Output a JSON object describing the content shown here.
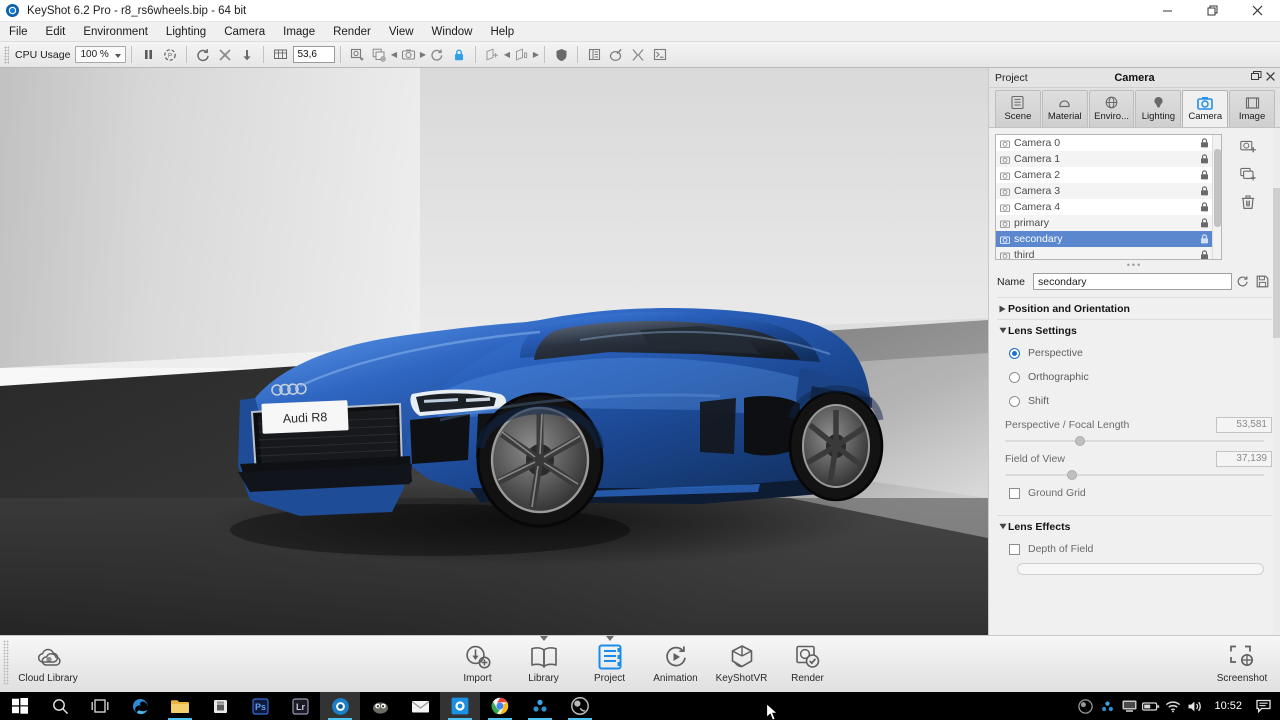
{
  "window": {
    "title": "KeyShot 6.2 Pro  - r8_rs6wheels.bip  - 64 bit",
    "logo_icon": "keyshot-logo-icon",
    "minimize_icon": "minimize-icon",
    "restore_icon": "restore-icon",
    "close_icon": "close-icon"
  },
  "menubar": {
    "items": [
      {
        "label": "File"
      },
      {
        "label": "Edit"
      },
      {
        "label": "Environment"
      },
      {
        "label": "Lighting"
      },
      {
        "label": "Camera"
      },
      {
        "label": "Image"
      },
      {
        "label": "Render"
      },
      {
        "label": "View"
      },
      {
        "label": "Window"
      },
      {
        "label": "Help"
      }
    ]
  },
  "toolbar": {
    "cpu_usage_label": "CPU Usage",
    "cpu_usage_value": "100 %",
    "numeric_value": "53,6",
    "buttons": [
      {
        "name": "pause-button",
        "icon": "pause-icon"
      },
      {
        "name": "performance-mode-button",
        "icon": "performance-icon"
      },
      {
        "name": "rotate-button",
        "icon": "rotate-icon"
      },
      {
        "name": "move-button",
        "icon": "move-icon"
      },
      {
        "name": "drop-to-ground-button",
        "icon": "down-arrow-icon"
      },
      {
        "name": "grid-button",
        "icon": "grid-icon"
      },
      {
        "name": "zoom-to-fit-button",
        "icon": "zoom-fit-icon"
      },
      {
        "name": "copy-view-button",
        "icon": "copy-view-icon"
      },
      {
        "name": "prev-camera-button",
        "icon": "left-arrow-icon"
      },
      {
        "name": "camera-button",
        "icon": "camera-icon"
      },
      {
        "name": "next-camera-button",
        "icon": "right-arrow-icon"
      },
      {
        "name": "reset-camera-button",
        "icon": "reset-icon"
      },
      {
        "name": "lock-camera-button",
        "icon": "lock-icon"
      },
      {
        "name": "add-model-set-button",
        "icon": "add-set-icon"
      },
      {
        "name": "prev-set-button",
        "icon": "left-arrow-icon"
      },
      {
        "name": "model-set-button",
        "icon": "model-set-icon"
      },
      {
        "name": "next-set-button",
        "icon": "right-arrow-icon"
      },
      {
        "name": "shield-button",
        "icon": "shield-icon"
      },
      {
        "name": "studio-button",
        "icon": "studio-icon"
      },
      {
        "name": "paint-button",
        "icon": "paint-icon"
      },
      {
        "name": "network-button",
        "icon": "network-icon"
      },
      {
        "name": "script-console-button",
        "icon": "console-icon"
      }
    ]
  },
  "viewport": {
    "name": "render-viewport",
    "license_plate_text": "Audi R8",
    "model": "Audi R8",
    "car_color": "#1f4fa8",
    "background": "studio-gradient"
  },
  "panel": {
    "left_label": "Project",
    "title": "Camera",
    "undock_icon": "undock-icon",
    "close_icon": "close-panel-icon",
    "tabs": [
      {
        "label": "Scene",
        "icon": "scene-icon",
        "active": false
      },
      {
        "label": "Material",
        "icon": "material-icon",
        "active": false
      },
      {
        "label": "Enviro...",
        "icon": "environment-icon",
        "active": false
      },
      {
        "label": "Lighting",
        "icon": "lighting-icon",
        "active": false
      },
      {
        "label": "Camera",
        "icon": "camera-icon",
        "active": true
      },
      {
        "label": "Image",
        "icon": "image-icon",
        "active": false
      }
    ],
    "camera_list": [
      {
        "label": "Camera 0",
        "selected": false,
        "locked": true
      },
      {
        "label": "Camera 1",
        "selected": false,
        "locked": true
      },
      {
        "label": "Camera 2",
        "selected": false,
        "locked": true
      },
      {
        "label": "Camera 3",
        "selected": false,
        "locked": true
      },
      {
        "label": "Camera 4",
        "selected": false,
        "locked": true
      },
      {
        "label": "primary",
        "selected": false,
        "locked": true
      },
      {
        "label": "secondary",
        "selected": true,
        "locked": true
      },
      {
        "label": "third",
        "selected": false,
        "locked": true
      }
    ],
    "list_tools": [
      {
        "name": "add-camera-button",
        "icon": "add-camera-icon"
      },
      {
        "name": "duplicate-camera-button",
        "icon": "duplicate-camera-icon"
      },
      {
        "name": "delete-camera-button",
        "icon": "trash-icon"
      }
    ],
    "name_label": "Name",
    "name_value": "secondary",
    "name_reset_icon": "refresh-icon",
    "name_save_icon": "save-icon",
    "sections": {
      "position": {
        "label": "Position and Orientation",
        "expanded": false
      },
      "lens_settings": {
        "label": "Lens Settings",
        "expanded": true,
        "modes": [
          {
            "label": "Perspective",
            "selected": true
          },
          {
            "label": "Orthographic",
            "selected": false
          },
          {
            "label": "Shift",
            "selected": false
          }
        ],
        "focal_length": {
          "label": "Perspective / Focal Length",
          "value": "53,581",
          "knob_pct": 27
        },
        "field_of_view": {
          "label": "Field of View",
          "value": "37,139",
          "knob_pct": 24
        },
        "ground_grid": {
          "label": "Ground Grid",
          "checked": false
        }
      },
      "lens_effects": {
        "label": "Lens Effects",
        "expanded": true,
        "depth_of_field": {
          "label": "Depth of Field",
          "checked": false
        }
      }
    }
  },
  "dock": {
    "items": [
      {
        "label": "Cloud Library",
        "icon": "cloud-library-icon",
        "active": false,
        "has_arrow": false
      },
      {
        "label": "Import",
        "icon": "import-icon",
        "active": false,
        "has_arrow": false
      },
      {
        "label": "Library",
        "icon": "library-icon",
        "active": false,
        "has_arrow": true
      },
      {
        "label": "Project",
        "icon": "project-icon",
        "active": true,
        "has_arrow": true
      },
      {
        "label": "Animation",
        "icon": "animation-icon",
        "active": false,
        "has_arrow": false
      },
      {
        "label": "KeyShotVR",
        "icon": "keyshotvr-icon",
        "active": false,
        "has_arrow": false
      },
      {
        "label": "Render",
        "icon": "render-icon",
        "active": false,
        "has_arrow": false
      },
      {
        "label": "Screenshot",
        "icon": "screenshot-icon",
        "active": false,
        "has_arrow": false
      }
    ]
  },
  "taskbar": {
    "items": [
      {
        "name": "start-button",
        "icon": "windows-logo-icon",
        "running": false,
        "focused": false
      },
      {
        "name": "search-button",
        "icon": "search-icon",
        "running": false,
        "focused": false
      },
      {
        "name": "task-view-button",
        "icon": "task-view-icon",
        "running": false,
        "focused": false
      },
      {
        "name": "edge-button",
        "icon": "edge-icon",
        "running": false,
        "focused": false
      },
      {
        "name": "file-explorer-button",
        "icon": "folder-icon",
        "running": true,
        "focused": false
      },
      {
        "name": "store-button",
        "icon": "store-icon",
        "running": false,
        "focused": false
      },
      {
        "name": "photoshop-button",
        "icon": "photoshop-icon",
        "running": false,
        "focused": false
      },
      {
        "name": "lightroom-button",
        "icon": "lightroom-icon",
        "running": false,
        "focused": false
      },
      {
        "name": "keyshot-button",
        "icon": "keyshot-icon",
        "running": true,
        "focused": true
      },
      {
        "name": "gimp-button",
        "icon": "gimp-icon",
        "running": false,
        "focused": false
      },
      {
        "name": "mail-button",
        "icon": "mail-icon",
        "running": false,
        "focused": false
      },
      {
        "name": "blue-app-button",
        "icon": "blue-app-icon",
        "running": true,
        "focused": true
      },
      {
        "name": "chrome-button",
        "icon": "chrome-icon",
        "running": true,
        "focused": false
      },
      {
        "name": "atom-app-button",
        "icon": "atom-icon",
        "running": true,
        "focused": false
      },
      {
        "name": "obs-button",
        "icon": "obs-icon",
        "running": true,
        "focused": false
      }
    ],
    "tray": [
      {
        "name": "tray-obs-icon",
        "icon": "obs-icon"
      },
      {
        "name": "tray-atom-icon",
        "icon": "atom-icon"
      },
      {
        "name": "tray-display-icon",
        "icon": "display-icon"
      },
      {
        "name": "tray-battery-icon",
        "icon": "battery-icon"
      },
      {
        "name": "tray-wifi-icon",
        "icon": "wifi-icon"
      },
      {
        "name": "tray-volume-icon",
        "icon": "volume-icon"
      }
    ],
    "clock": "10:52",
    "action_center_icon": "action-center-icon"
  }
}
